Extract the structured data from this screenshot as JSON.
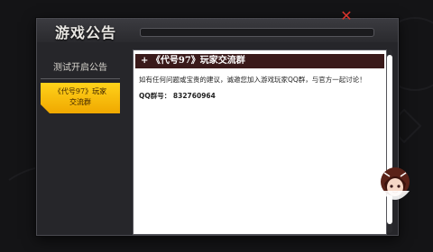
{
  "dialog": {
    "title": "游戏公告",
    "close_symbol": "✕"
  },
  "sidebar": {
    "items": [
      {
        "label": "测试开启公告"
      },
      {
        "label_line1": "《代号97》玩家",
        "label_line2": "交流群"
      }
    ]
  },
  "content": {
    "title": "+ 《代号97》玩家交流群",
    "body": "如有任何问题或宝贵的建议，诚邀您加入游戏玩家QQ群，与官方一起讨论！",
    "qq_label": "QQ群号：",
    "qq_number": "832760964"
  },
  "colors": {
    "accent": "#ffc400",
    "close": "#d8342c",
    "title_bar": "#3a1a1a"
  },
  "icons": {
    "close": "close-icon",
    "mascot": "mascot-icon"
  }
}
